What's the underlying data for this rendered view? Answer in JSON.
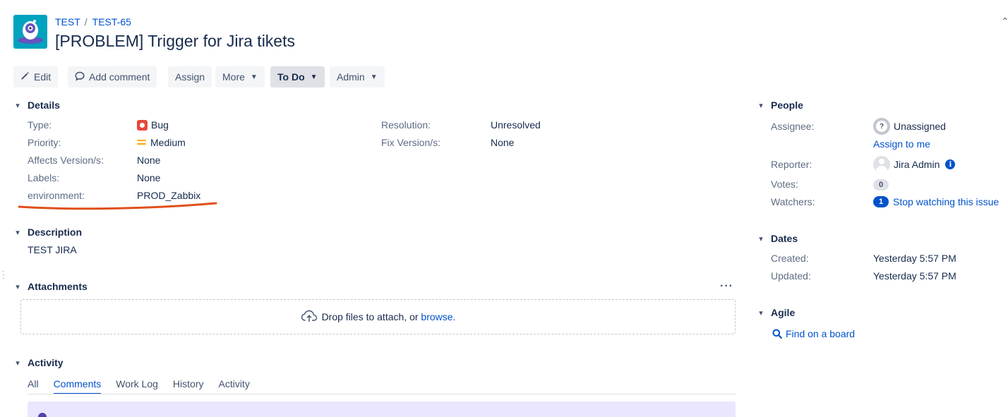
{
  "breadcrumb": {
    "project": "TEST",
    "separator": "/",
    "issue_key": "TEST-65"
  },
  "issue": {
    "title": "[PROBLEM] Trigger for Jira tikets"
  },
  "toolbar": {
    "edit": "Edit",
    "add_comment": "Add comment",
    "assign": "Assign",
    "more": "More",
    "status": "To Do",
    "admin": "Admin"
  },
  "details": {
    "heading": "Details",
    "type_label": "Type:",
    "type_value": "Bug",
    "priority_label": "Priority:",
    "priority_value": "Medium",
    "affects_label": "Affects Version/s:",
    "affects_value": "None",
    "labels_label": "Labels:",
    "labels_value": "None",
    "environment_label": "environment:",
    "environment_value": "PROD_Zabbix",
    "resolution_label": "Resolution:",
    "resolution_value": "Unresolved",
    "fix_label": "Fix Version/s:",
    "fix_value": "None"
  },
  "description": {
    "heading": "Description",
    "text": "TEST JIRA"
  },
  "attachments": {
    "heading": "Attachments",
    "drop_text": "Drop files to attach, or",
    "browse_link": "browse."
  },
  "activity": {
    "heading": "Activity",
    "tabs": [
      "All",
      "Comments",
      "Work Log",
      "History",
      "Activity"
    ],
    "active_tab": "Comments"
  },
  "people": {
    "heading": "People",
    "assignee_label": "Assignee:",
    "assignee_value": "Unassigned",
    "assign_to_me": "Assign to me",
    "reporter_label": "Reporter:",
    "reporter_value": "Jira Admin",
    "votes_label": "Votes:",
    "votes_count": "0",
    "watchers_label": "Watchers:",
    "watchers_count": "1",
    "stop_watching": "Stop watching this issue"
  },
  "dates": {
    "heading": "Dates",
    "created_label": "Created:",
    "created_value": "Yesterday 5:57 PM",
    "updated_label": "Updated:",
    "updated_value": "Yesterday 5:57 PM"
  },
  "agile": {
    "heading": "Agile",
    "find_on_board": "Find on a board"
  },
  "colors": {
    "link": "#0052cc",
    "annotation_underline": "#e0501b",
    "bug": "#e5493a",
    "priority_medium": "#ffab00",
    "project_avatar": "#00a3bf"
  },
  "icons": [
    "pencil-icon",
    "comment-icon",
    "chevron-down-icon",
    "bug-icon",
    "priority-medium-icon",
    "cloud-upload-icon",
    "search-icon",
    "info-icon",
    "more-icon"
  ]
}
